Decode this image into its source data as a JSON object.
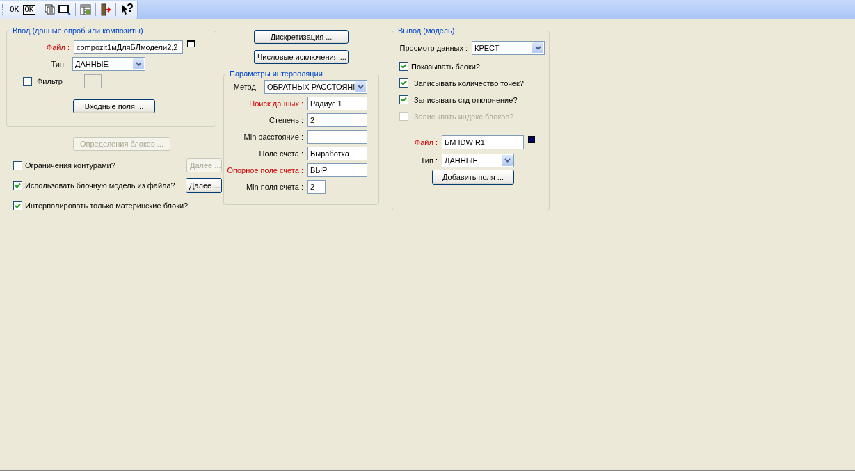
{
  "toolbar": {
    "groups": [
      [
        {
          "kind": "text",
          "label": "OK"
        },
        {
          "kind": "boxed",
          "label": "OK"
        }
      ],
      [
        {
          "kind": "copy"
        },
        {
          "kind": "window"
        }
      ],
      [
        {
          "kind": "table"
        }
      ],
      [
        {
          "kind": "exit"
        }
      ],
      [
        {
          "kind": "help"
        }
      ]
    ]
  },
  "input_group": {
    "title": "Ввод (данные опроб или композиты)",
    "file": {
      "label": "Файл :",
      "value": "compozit1мДляБЛмодели2,2",
      "required": true
    },
    "type": {
      "label": "Тип :",
      "value": "ДАННЫЕ"
    },
    "filter": {
      "label": "Фильтр",
      "checked": false
    },
    "button": "Входные поля ..."
  },
  "block_definitions_button": {
    "label": "Определения блоков ...",
    "disabled": true
  },
  "options": [
    {
      "label": "Ограничения контурами?",
      "checked": false,
      "more_button": {
        "label": "Далее ...",
        "disabled": true
      }
    },
    {
      "label": "Использовать блочную модель из файла?",
      "checked": true,
      "more_button": {
        "label": "Далее ...",
        "disabled": false
      }
    },
    {
      "label": "Интерполировать только материнские блоки?",
      "checked": true
    }
  ],
  "center_buttons": [
    "Дискретизация ...",
    "Числовые исключения ..."
  ],
  "interpolation": {
    "title": "Параметры интерполяции",
    "rows": [
      {
        "kind": "select",
        "label": "Метод :",
        "value": "ОБРАТНЫХ РАССТОЯНІ",
        "required": false
      },
      {
        "kind": "text",
        "label": "Поиск данных :",
        "value": "Радиус 1",
        "required": true
      },
      {
        "kind": "text",
        "label": "Степень  :",
        "value": "2",
        "required": false
      },
      {
        "kind": "text",
        "label": "Min расстояние :",
        "required": false
      },
      {
        "kind": "text",
        "label": "Поле счета :",
        "value": "Выработка",
        "required": false
      },
      {
        "kind": "text",
        "label": "Опорное поле счета :",
        "value": "ВЫР",
        "required": true
      },
      {
        "kind": "short",
        "label": "Min поля счета :",
        "value": "2",
        "required": false
      }
    ]
  },
  "output_group": {
    "title": "Вывод (модель)",
    "view": {
      "label": "Просмотр данных :",
      "value": "КРЕСТ"
    },
    "checks": [
      {
        "label": "Показывать блоки?",
        "checked": true,
        "disabled": false
      },
      {
        "label": "Записывать количество точек?",
        "checked": true,
        "disabled": false
      },
      {
        "label": "Записывать стд отклонение?",
        "checked": true,
        "disabled": false
      },
      {
        "label": "Записывать индекс блоков?",
        "checked": false,
        "disabled": true
      }
    ],
    "file": {
      "label": "Файл :",
      "value": "БМ IDW R1",
      "required": true,
      "color": "#000066"
    },
    "type": {
      "label": "Тип :",
      "value": "ДАННЫЕ"
    },
    "button": "Добавить поля ..."
  }
}
